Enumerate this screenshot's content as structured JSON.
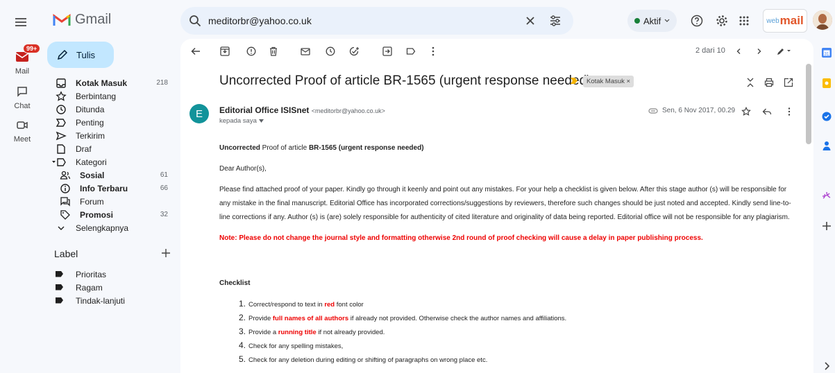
{
  "rail": {
    "badge": "99+",
    "items": [
      {
        "label": "Mail"
      },
      {
        "label": "Chat"
      },
      {
        "label": "Meet"
      }
    ]
  },
  "brand": {
    "name": "Gmail"
  },
  "search": {
    "value": "meditorbr@yahoo.co.uk"
  },
  "status": {
    "label": "Aktif"
  },
  "webmail": {
    "prefix": "web",
    "name": "mail"
  },
  "compose": {
    "label": "Tulis"
  },
  "nav": [
    {
      "label": "Kotak Masuk",
      "count": "218",
      "bold": true
    },
    {
      "label": "Berbintang",
      "count": ""
    },
    {
      "label": "Ditunda",
      "count": ""
    },
    {
      "label": "Penting",
      "count": ""
    },
    {
      "label": "Terkirim",
      "count": ""
    },
    {
      "label": "Draf",
      "count": ""
    },
    {
      "label": "Kategori",
      "count": ""
    },
    {
      "label": "Sosial",
      "count": "61",
      "bold": true
    },
    {
      "label": "Info Terbaru",
      "count": "66",
      "bold": true
    },
    {
      "label": "Forum",
      "count": ""
    },
    {
      "label": "Promosi",
      "count": "32",
      "bold": true
    },
    {
      "label": "Selengkapnya",
      "count": ""
    }
  ],
  "labels": {
    "heading": "Label",
    "items": [
      "Prioritas",
      "Ragam",
      "Tindak-lanjuti"
    ]
  },
  "toolbar": {
    "pager": "2 dari 10"
  },
  "email": {
    "subject": "Uncorrected Proof of article BR-1565 (urgent response needed)",
    "chip": "Kotak Masuk ×",
    "sender_name": "Editorial Office ISISnet",
    "sender_email": "<meditorbr@yahoo.co.uk>",
    "to_me": "kepada saya",
    "date": "Sen, 6 Nov 2017, 00.29",
    "body": {
      "heading_b1": "Uncorrected",
      "heading_t1": " Proof of article ",
      "heading_b2": "BR-1565 (urgent response needed)",
      "greeting": "Dear Author(s),",
      "paragraph": "Please find attached proof of your paper.  Kindly go through it keenly and point out any mistakes. For your help a checklist is given below. After this stage author (s) will be responsible for any mistake in the final manuscript. Editorial Office has incorporated corrections/suggestions by reviewers, therefore such changes should be just noted and accepted. Kindly send line-to-line corrections if any. Author (s) is (are) solely responsible for authenticity of cited literature and originality of data being reported. Editorial office will not be responsible for any plagiarism.",
      "note": "Note: Please do not change the journal style and formatting otherwise 2nd round of proof checking will cause a delay in paper publishing process.",
      "checklist_heading": "Checklist",
      "checklist": [
        {
          "num": "1.",
          "pre": "Correct/respond to text in ",
          "red": "red",
          "post": " font color"
        },
        {
          "num": "2.",
          "pre": "Provide ",
          "red": "full names of all authors",
          "post": " if already not provided. Otherwise check the author names and affiliations."
        },
        {
          "num": "3.",
          "pre": "Provide a ",
          "red": "running title",
          "post": " if not already provided."
        },
        {
          "num": "4.",
          "pre": "Check for any spelling mistakes,",
          "red": "",
          "post": ""
        },
        {
          "num": "5.",
          "pre": "Check for any deletion during editing or shifting of paragraphs on wrong place etc.",
          "red": "",
          "post": ""
        }
      ]
    }
  },
  "colors": {
    "accent": "#c2e7ff",
    "search_bg": "#eaf1fb",
    "note_red": "#ee0000",
    "sender_avatar": "#12939a",
    "badge": "#d93025"
  },
  "icons": [
    "menu-icon",
    "mail-icon",
    "chat-icon",
    "meet-icon",
    "search-icon",
    "clear-icon",
    "filter-icon",
    "help-icon",
    "settings-icon",
    "apps-icon",
    "pencil-icon",
    "back-icon",
    "archive-icon",
    "report-icon",
    "delete-icon",
    "mark-unread-icon",
    "snooze-icon",
    "add-task-icon",
    "move-icon",
    "label-icon",
    "more-icon",
    "prev-icon",
    "next-icon",
    "collapse-icon",
    "print-icon",
    "open-new-icon",
    "attachment-icon",
    "star-icon",
    "reply-icon"
  ]
}
